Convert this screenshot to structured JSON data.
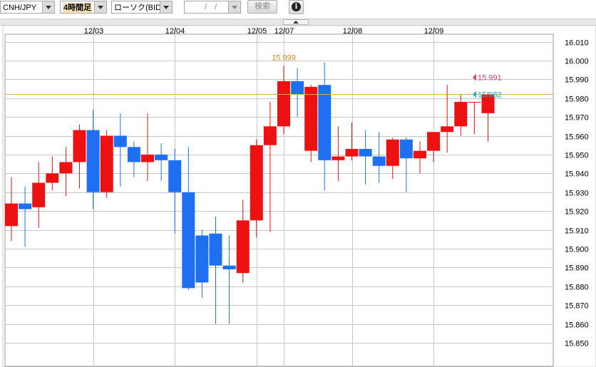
{
  "toolbar": {
    "symbol": "CNH/JPY",
    "period": "4時間足",
    "chart_type": "ローソク(BID)",
    "date_value": "/ /",
    "search_label": "検索",
    "info_icon": "info-icon"
  },
  "colors": {
    "up": "#ee1111",
    "down": "#1e6ff2",
    "grid": "#c8c8c8",
    "ask_line": "#d4b43c",
    "ask_label": "#e0407a",
    "bid_label": "#1fb0c8",
    "high_label": "#e08a2a"
  },
  "chart_data": {
    "type": "candlestick",
    "ylim": [
      15.85,
      16.01
    ],
    "yticks": [
      "16.010",
      "16.000",
      "15.990",
      "15.980",
      "15.970",
      "15.960",
      "15.950",
      "15.940",
      "15.930",
      "15.920",
      "15.910",
      "15.900",
      "15.890",
      "15.880",
      "15.870",
      "15.860",
      "15.850"
    ],
    "date_labels": [
      {
        "label": "12/03",
        "index": 6
      },
      {
        "label": "12/04",
        "index": 12
      },
      {
        "label": "12/05",
        "index": 18
      },
      {
        "label": "12/07",
        "index": 20
      },
      {
        "label": "12/08",
        "index": 25
      },
      {
        "label": "12/09",
        "index": 31
      }
    ],
    "candles": [
      {
        "o": 15.912,
        "h": 15.938,
        "l": 15.904,
        "c": 15.924
      },
      {
        "o": 15.924,
        "h": 15.933,
        "l": 15.901,
        "c": 15.921
      },
      {
        "o": 15.922,
        "h": 15.946,
        "l": 15.911,
        "c": 15.935
      },
      {
        "o": 15.935,
        "h": 15.949,
        "l": 15.931,
        "c": 15.94
      },
      {
        "o": 15.94,
        "h": 15.954,
        "l": 15.928,
        "c": 15.946
      },
      {
        "o": 15.946,
        "h": 15.966,
        "l": 15.932,
        "c": 15.963
      },
      {
        "o": 15.963,
        "h": 15.974,
        "l": 15.921,
        "c": 15.93
      },
      {
        "o": 15.93,
        "h": 15.963,
        "l": 15.927,
        "c": 15.96
      },
      {
        "o": 15.96,
        "h": 15.972,
        "l": 15.933,
        "c": 15.954
      },
      {
        "o": 15.954,
        "h": 15.957,
        "l": 15.938,
        "c": 15.946
      },
      {
        "o": 15.946,
        "h": 15.972,
        "l": 15.936,
        "c": 15.95
      },
      {
        "o": 15.95,
        "h": 15.956,
        "l": 15.936,
        "c": 15.947
      },
      {
        "o": 15.947,
        "h": 15.953,
        "l": 15.908,
        "c": 15.93
      },
      {
        "o": 15.93,
        "h": 15.954,
        "l": 15.878,
        "c": 15.879
      },
      {
        "o": 15.907,
        "h": 15.91,
        "l": 15.874,
        "c": 15.882
      },
      {
        "o": 15.908,
        "h": 15.917,
        "l": 15.86,
        "c": 15.891
      },
      {
        "o": 15.891,
        "h": 15.907,
        "l": 15.86,
        "c": 15.889
      },
      {
        "o": 15.887,
        "h": 15.926,
        "l": 15.882,
        "c": 15.915
      },
      {
        "o": 15.915,
        "h": 15.958,
        "l": 15.906,
        "c": 15.955
      },
      {
        "o": 15.955,
        "h": 15.978,
        "l": 15.909,
        "c": 15.965
      },
      {
        "o": 15.965,
        "h": 15.997,
        "l": 15.961,
        "c": 15.989
      },
      {
        "o": 15.989,
        "h": 15.996,
        "l": 15.97,
        "c": 15.982
      },
      {
        "o": 15.952,
        "h": 15.987,
        "l": 15.946,
        "c": 15.986
      },
      {
        "o": 15.987,
        "h": 15.999,
        "l": 15.931,
        "c": 15.947
      },
      {
        "o": 15.947,
        "h": 15.965,
        "l": 15.936,
        "c": 15.949
      },
      {
        "o": 15.949,
        "h": 15.967,
        "l": 15.947,
        "c": 15.953
      },
      {
        "o": 15.953,
        "h": 15.963,
        "l": 15.934,
        "c": 15.949
      },
      {
        "o": 15.949,
        "h": 15.962,
        "l": 15.935,
        "c": 15.944
      },
      {
        "o": 15.944,
        "h": 15.959,
        "l": 15.937,
        "c": 15.958
      },
      {
        "o": 15.958,
        "h": 15.959,
        "l": 15.93,
        "c": 15.948
      },
      {
        "o": 15.948,
        "h": 15.957,
        "l": 15.94,
        "c": 15.952
      },
      {
        "o": 15.952,
        "h": 15.962,
        "l": 15.946,
        "c": 15.962
      },
      {
        "o": 15.962,
        "h": 15.987,
        "l": 15.951,
        "c": 15.965
      },
      {
        "o": 15.965,
        "h": 15.982,
        "l": 15.96,
        "c": 15.978
      },
      {
        "o": 15.978,
        "h": 15.978,
        "l": 15.961,
        "c": 15.978
      },
      {
        "o": 15.972,
        "h": 15.983,
        "l": 15.957,
        "c": 15.982
      }
    ],
    "annotations": {
      "high_label": "15.999",
      "high_value": 15.999,
      "high_index": 20,
      "ask_label": "15.991",
      "ask_value": 15.991,
      "bid_label": "15.982",
      "bid_value": 15.982
    }
  }
}
